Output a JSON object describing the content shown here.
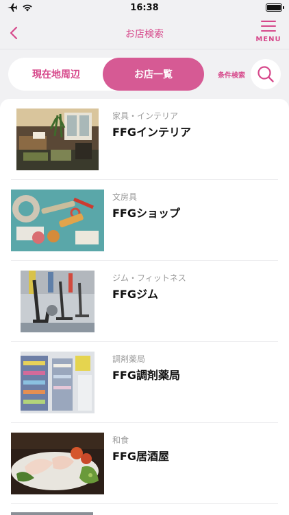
{
  "status_bar": {
    "time": "16:38",
    "icons": [
      "airplane-icon",
      "wifi-icon",
      "battery-icon"
    ]
  },
  "header": {
    "title": "お店検索",
    "menu_label": "MENU"
  },
  "tabs": [
    {
      "label": "現在地周辺",
      "selected": false
    },
    {
      "label": "お店一覧",
      "selected": true
    }
  ],
  "filter": {
    "label": "条件検索"
  },
  "stores": [
    {
      "category": "家具・インテリア",
      "name": "FFGインテリア"
    },
    {
      "category": "文房具",
      "name": "FFGショップ"
    },
    {
      "category": "ジム・フィットネス",
      "name": "FFGジム"
    },
    {
      "category": "調剤薬局",
      "name": "FFG調剤薬局"
    },
    {
      "category": "和食",
      "name": "FFG居酒屋"
    }
  ],
  "colors": {
    "accent": "#d6478a",
    "tab_selected_bg": "#d65a94",
    "background": "#f1f1f3"
  }
}
